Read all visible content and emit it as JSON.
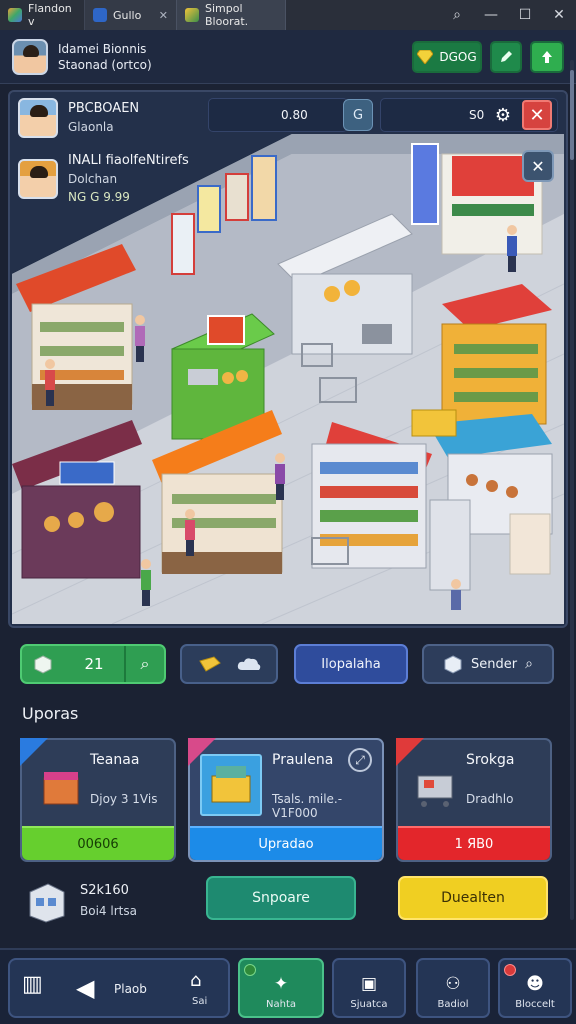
{
  "window": {
    "tabs": [
      {
        "label": "Flandon v"
      },
      {
        "label": "Gullo"
      },
      {
        "label": "Simpol Bloorat."
      }
    ]
  },
  "header": {
    "line1": "Idamei Bionnis",
    "line2": "Staonad (ortco)",
    "gem_label": "DGOG"
  },
  "panel": {
    "profile1": {
      "name": "PBCBOAEN",
      "sub": "Glaonla"
    },
    "profile2": {
      "name": "INALI fiaolfeNtirefs",
      "sub": "Dolchan",
      "stats": "NG G 9.99"
    },
    "stat1_value": "0.80",
    "stat2_value": "S0"
  },
  "actions": {
    "green_label": "21",
    "blue_label": "Ilopalaha",
    "send_label": "Sender"
  },
  "section_title": "Uporas",
  "cards": [
    {
      "name": "Teanaa",
      "sub": "Djoy 3 1Vis",
      "button": "00606",
      "color": "#66cf2e"
    },
    {
      "name": "Praulena",
      "sub": "Tsals. mile.-V1F000",
      "button": "Upradao",
      "color": "#1c8be8"
    },
    {
      "name": "Srokga",
      "sub": "Dradhlo",
      "button": "1 ЯВ0",
      "color": "#e3262b"
    }
  ],
  "bottom": {
    "info_line1": "S2k160",
    "info_line2": "Boi4 lrtsa",
    "teal_button": "Snpoare",
    "yellow_button": "Duealten"
  },
  "nav": {
    "left_label": "Plaob",
    "left_sub": "Sai",
    "items": [
      {
        "label": "Nahta",
        "icon": "puzzle-icon"
      },
      {
        "label": "Sjuatca",
        "icon": "window-icon"
      },
      {
        "label": "Badiol",
        "icon": "people-icon"
      },
      {
        "label": "Bloccelt",
        "icon": "face-icon"
      }
    ]
  },
  "colors": {
    "accent_green": "#2f9e52",
    "accent_blue": "#2f4c9c",
    "danger": "#d6433f",
    "background": "#1b2233"
  }
}
